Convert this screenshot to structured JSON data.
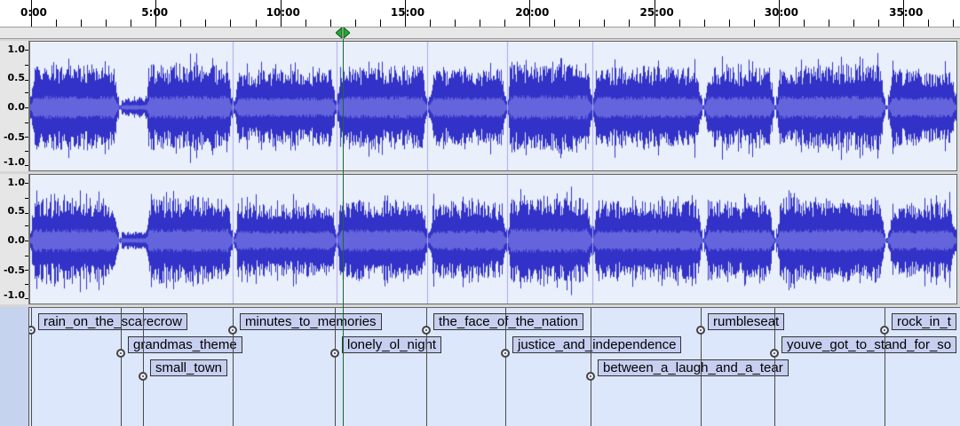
{
  "timeline": {
    "ticks": [
      "0:00",
      "5:00",
      "10:00",
      "15:00",
      "20:00",
      "25:00",
      "30:00",
      "35:00"
    ]
  },
  "tracks": [
    {
      "name": "audio-track-left",
      "scale": [
        "1.0",
        "0.5",
        "0.0",
        "-0.5",
        "-1.0"
      ]
    },
    {
      "name": "audio-track-right",
      "scale": [
        "1.0",
        "0.5",
        "0.0",
        "-0.5",
        "-1.0"
      ]
    }
  ],
  "colors": {
    "waveform": "#3232c8",
    "waveform_rms": "#6464dc",
    "track_bg": "#eaf0fb",
    "cursor": "#1a6b2e",
    "playhead": "#22aa33"
  },
  "label_track": {
    "labels": [
      {
        "text": "rain_on_the_scarecrow",
        "row": 0
      },
      {
        "text": "grandmas_theme",
        "row": 1
      },
      {
        "text": "small_town",
        "row": 2
      },
      {
        "text": "minutes_to_memories",
        "row": 0
      },
      {
        "text": "lonely_ol_night",
        "row": 1
      },
      {
        "text": "the_face_of_the_nation",
        "row": 0
      },
      {
        "text": "justice_and_independence",
        "row": 1
      },
      {
        "text": "between_a_laugh_and_a_tear",
        "row": 2
      },
      {
        "text": "rumbleseat",
        "row": 0
      },
      {
        "text": "youve_got_to_stand_for_so",
        "row": 1
      },
      {
        "text": "rock_in_t",
        "row": 0
      }
    ]
  }
}
